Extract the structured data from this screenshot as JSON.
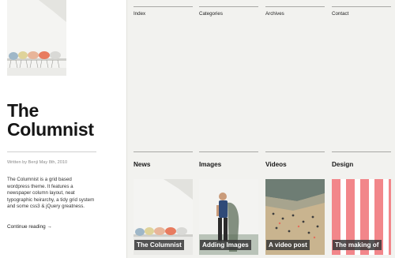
{
  "post": {
    "title_line1": "The",
    "title_line2": "Columnist",
    "meta": "Written by Benji May 8th, 2010",
    "description": "The Columnist is a grid based wordpress theme. It features a newspaper column layout, neat typographic heirarchy, a tidy grid system and some css3 & jQuery greatness.",
    "continue_label": "Continue reading →"
  },
  "nav": {
    "items": [
      "Index",
      "Categories",
      "Archives",
      "Contact"
    ]
  },
  "sections": {
    "heads": [
      "News",
      "Images",
      "Videos",
      "Design"
    ],
    "captions": [
      "The Columnist",
      "Adding Images",
      "A video post",
      "The making of"
    ]
  },
  "colors": {
    "panel_bg": "#f2f2ef",
    "caption_bg": "#373737",
    "design_stripe": "#f2868a"
  }
}
